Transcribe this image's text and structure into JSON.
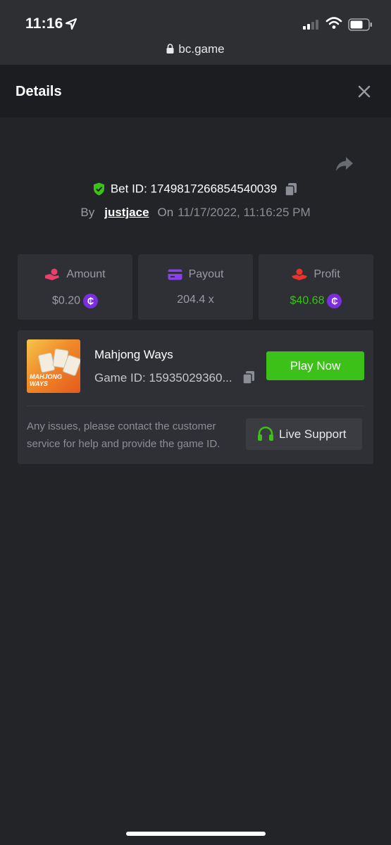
{
  "status_bar": {
    "time": "11:16",
    "url": "bc.game"
  },
  "header": {
    "title": "Details"
  },
  "bet": {
    "id_label": "Bet ID: 1749817266854540039",
    "by_label": "By",
    "user": "justjace",
    "on_label": "On",
    "date": "11/17/2022, 11:16:25 PM"
  },
  "stats": [
    {
      "label": "Amount",
      "value": "$0.20",
      "icon": "hand-coins-icon"
    },
    {
      "label": "Payout",
      "value": "204.4 x",
      "icon": "card-icon"
    },
    {
      "label": "Profit",
      "value": "$40.68",
      "icon": "profit-hand-icon"
    }
  ],
  "game": {
    "name": "Mahjong Ways",
    "id_text": "Game ID: 15935029360...",
    "play_label": "Play Now",
    "thumb_text": "MAHJONG WAYS",
    "support_text": "Any issues, please contact the customer service for help and provide the game ID.",
    "support_label": "Live Support"
  },
  "coin_symbol": "₵",
  "colors": {
    "accent_green": "#3bc117",
    "coin_purple": "#7b2ee0",
    "background": "#232428"
  }
}
